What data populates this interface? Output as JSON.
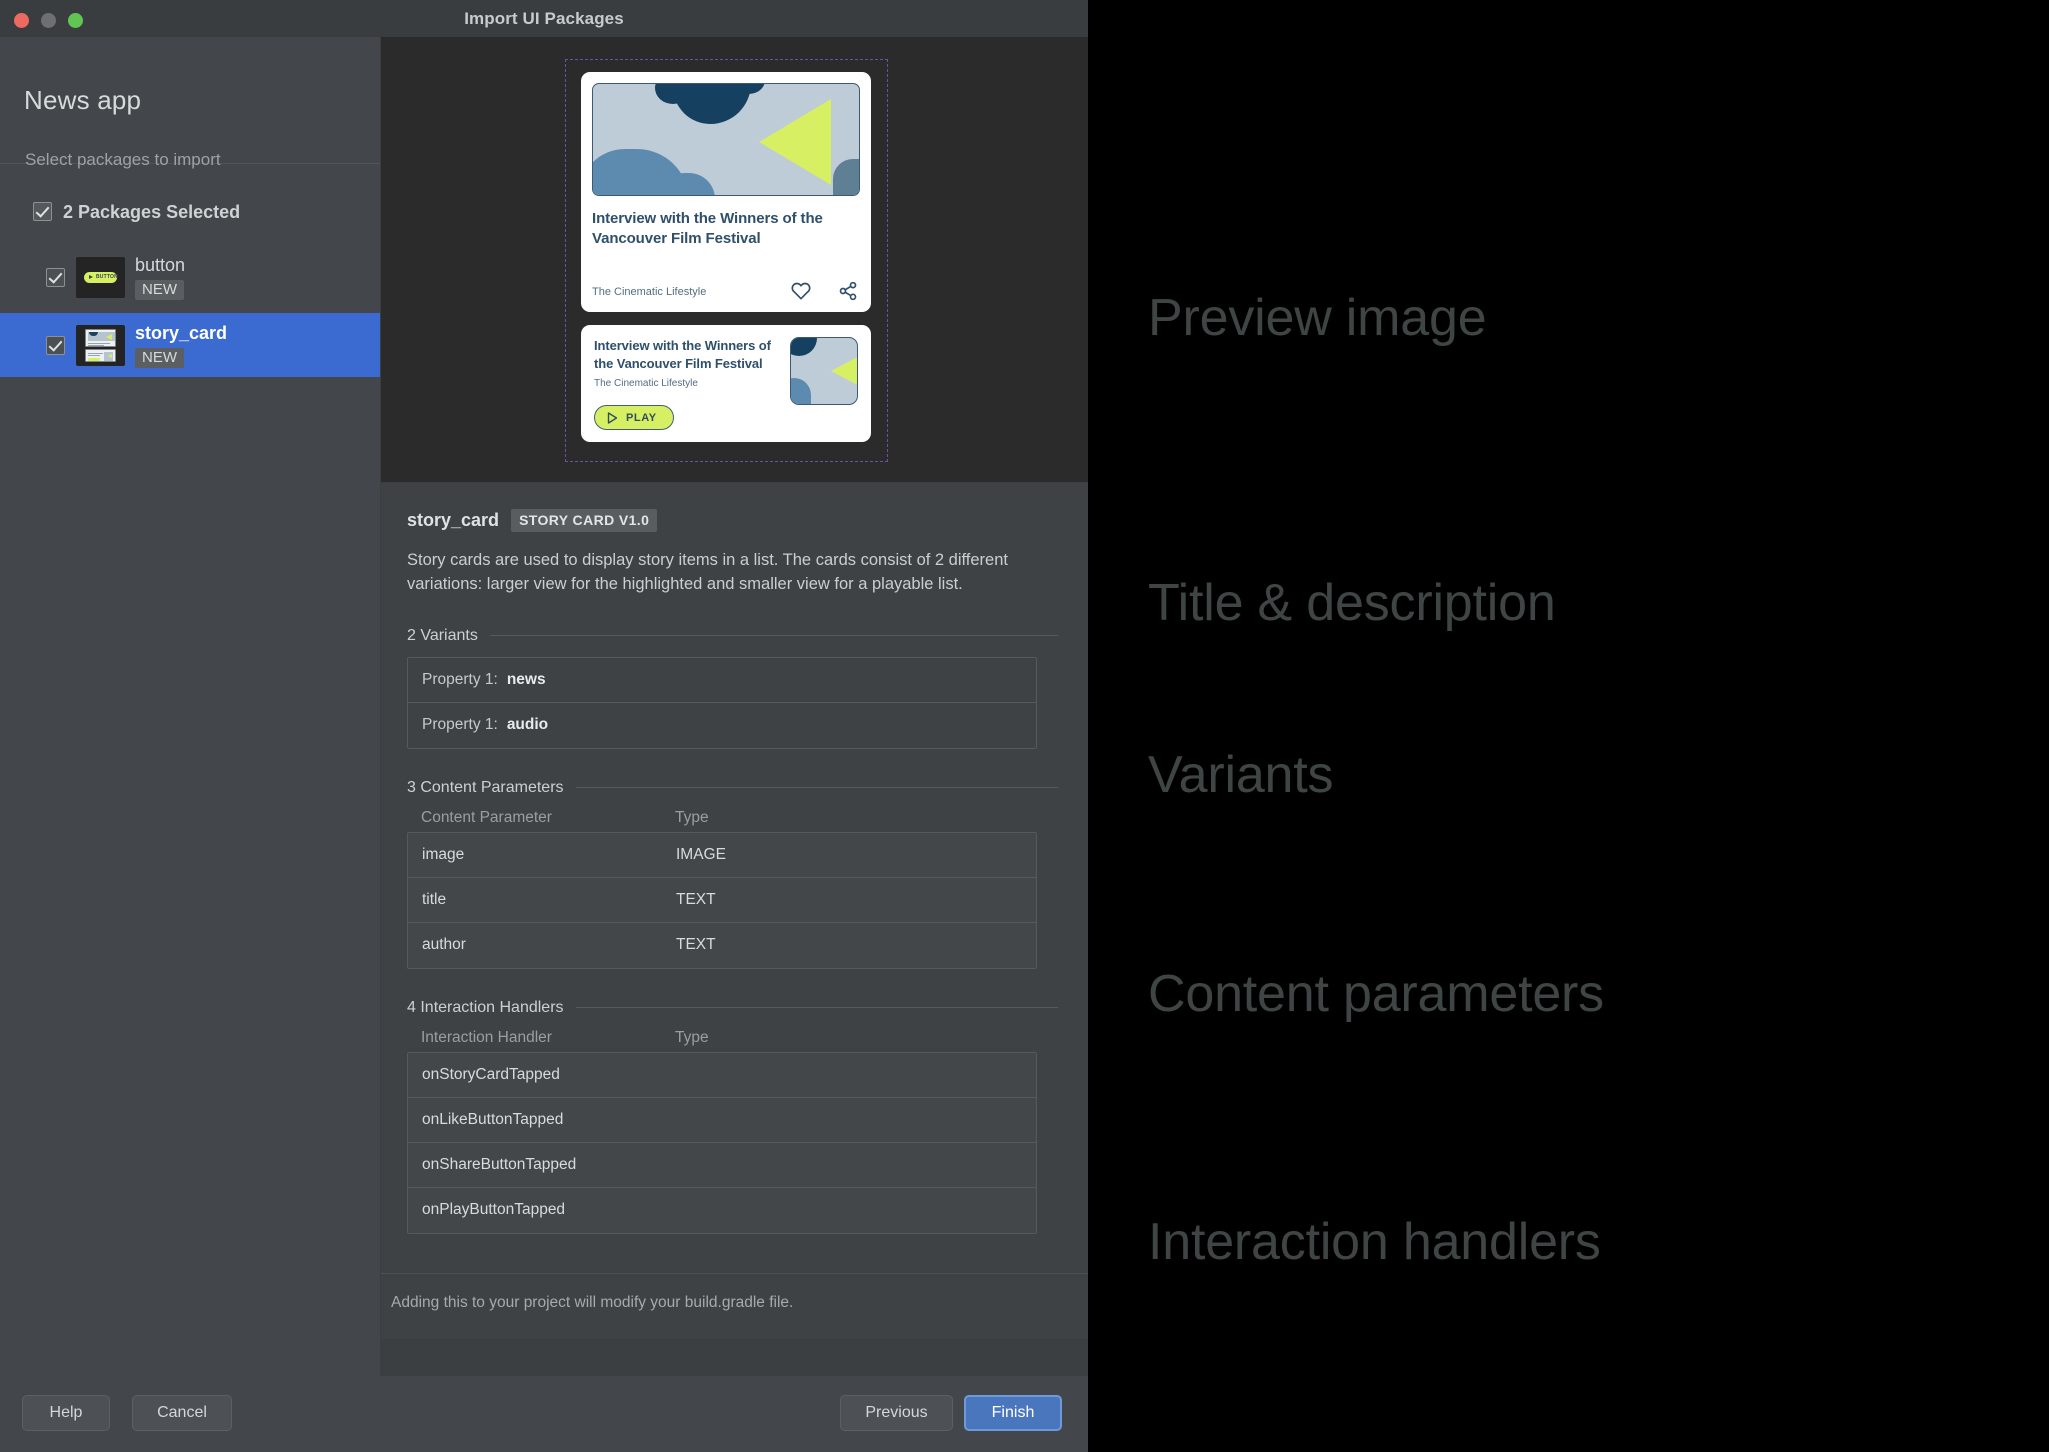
{
  "window": {
    "title": "Import UI Packages",
    "traffic_lights": [
      "close",
      "minimize",
      "maximize"
    ]
  },
  "sidebar": {
    "app_title": "News app",
    "subtitle": "Select packages to import",
    "select_all_label": "2 Packages Selected",
    "packages": [
      {
        "name": "button",
        "badge": "NEW",
        "checked": true,
        "selected": false
      },
      {
        "name": "story_card",
        "badge": "NEW",
        "checked": true,
        "selected": true
      }
    ]
  },
  "preview": {
    "large_card": {
      "title": "Interview with the Winners of the Vancouver Film Festival",
      "author": "The Cinematic Lifestyle",
      "like_icon": "heart-icon",
      "share_icon": "share-icon"
    },
    "small_card": {
      "title": "Interview with the Winners of the Vancouver Film Festival",
      "author": "The Cinematic Lifestyle",
      "play_label": "PLAY"
    },
    "colors": {
      "accent_green": "#d7ef63",
      "navy": "#16405f",
      "steel": "#5d8bb0",
      "image_bg": "#bdccd6",
      "text_blue": "#2f4f6b",
      "dashed_border": "#6b4fa8"
    }
  },
  "detail": {
    "component_name": "story_card",
    "version_badge": "STORY CARD V1.0",
    "description": "Story cards are used to display story items in a list. The cards consist of 2 different variations: larger view for the highlighted and smaller view for a playable list.",
    "variants": {
      "heading": "2 Variants",
      "rows": [
        {
          "label": "Property 1:",
          "value": "news"
        },
        {
          "label": "Property 1:",
          "value": "audio"
        }
      ]
    },
    "content_parameters": {
      "heading": "3 Content Parameters",
      "columns": [
        "Content Parameter",
        "Type"
      ],
      "rows": [
        {
          "name": "image",
          "type": "IMAGE"
        },
        {
          "name": "title",
          "type": "TEXT"
        },
        {
          "name": "author",
          "type": "TEXT"
        }
      ]
    },
    "interaction_handlers": {
      "heading": "4 Interaction Handlers",
      "columns": [
        "Interaction Handler",
        "Type"
      ],
      "rows": [
        {
          "name": "onStoryCardTapped",
          "type": ""
        },
        {
          "name": "onLikeButtonTapped",
          "type": ""
        },
        {
          "name": "onShareButtonTapped",
          "type": ""
        },
        {
          "name": "onPlayButtonTapped",
          "type": ""
        }
      ]
    },
    "footnote": "Adding this to your project will modify your build.gradle file."
  },
  "bottom_bar": {
    "help": "Help",
    "cancel": "Cancel",
    "previous": "Previous",
    "finish": "Finish",
    "finish_color": "#4a76bd"
  },
  "annotations": {
    "preview": "Preview image",
    "title_description": "Title & description",
    "variants": "Variants",
    "content_parameters": "Content parameters",
    "interaction_handlers": "Interaction handlers",
    "color": "#3f4544"
  }
}
